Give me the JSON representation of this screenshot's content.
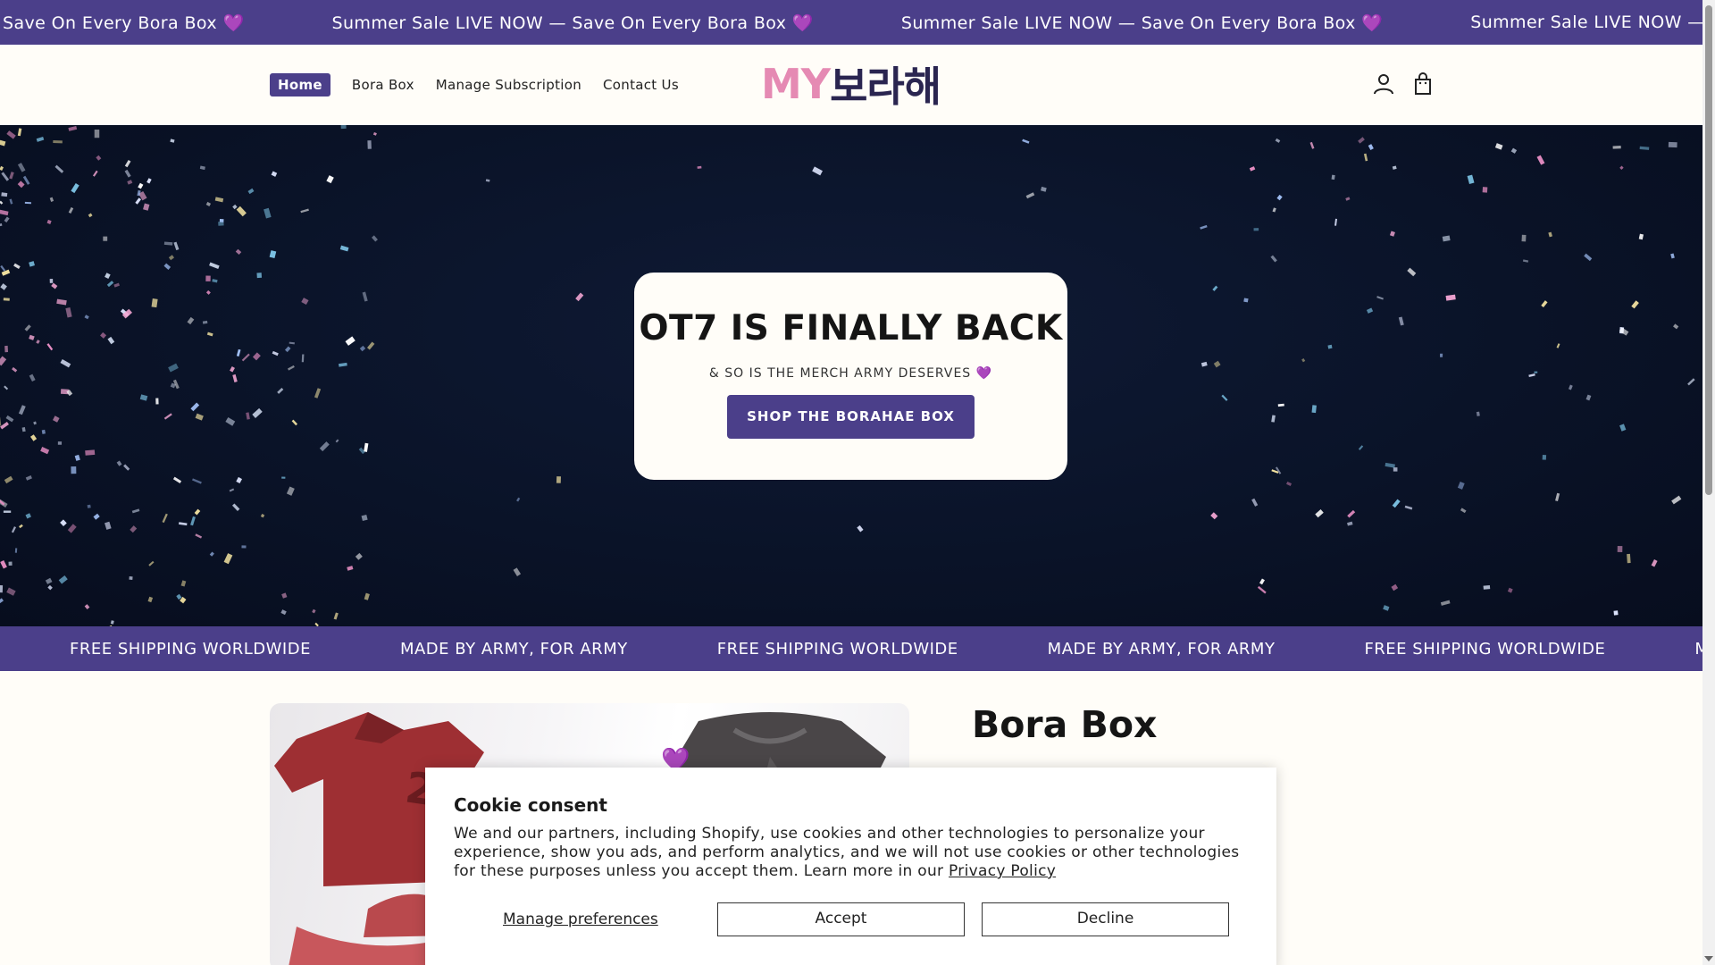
{
  "announcement": {
    "items": [
      "Save On Every Bora Box 💜",
      "Summer Sale LIVE NOW — Save On Every Bora Box 💜",
      "Summer Sale LIVE NOW — Save On Every Bora Box 💜",
      "Summer Sale LIVE NOW — Save O"
    ]
  },
  "nav": {
    "items": [
      "Home",
      "Bora Box",
      "Manage Subscription",
      "Contact Us"
    ],
    "active": "Home"
  },
  "logo": {
    "latin": "MY",
    "korean": "보라해"
  },
  "header_icons": [
    "account-icon",
    "cart-icon"
  ],
  "hero": {
    "title": "OT7 IS FINALLY BACK",
    "subtitle": "& SO IS THE MERCH ARMY DESERVES 💜",
    "button": "SHOP THE BORAHAE BOX"
  },
  "strip": {
    "items": [
      "FREE SHIPPING WORLDWIDE",
      "MADE BY ARMY, FOR ARMY",
      "FREE SHIPPING WORLDWIDE",
      "MADE BY ARMY, FOR ARMY",
      "FREE SHIPPING WORLDWIDE",
      "MADE B"
    ]
  },
  "product": {
    "title": "Bora Box"
  },
  "cookie": {
    "title": "Cookie consent",
    "text": "We and our partners, including Shopify, use cookies and other technologies to personalize your experience, show you ads, and perform analytics, and we will not use cookies or other technologies for these purposes unless you accept them. Learn more in our ",
    "policy_link": "Privacy Policy",
    "manage": "Manage preferences",
    "accept": "Accept",
    "decline": "Decline"
  },
  "colors": {
    "brand": "#4b3f8a",
    "logo_pink": "#e58ab3",
    "hero_bg": "#0a1328"
  }
}
